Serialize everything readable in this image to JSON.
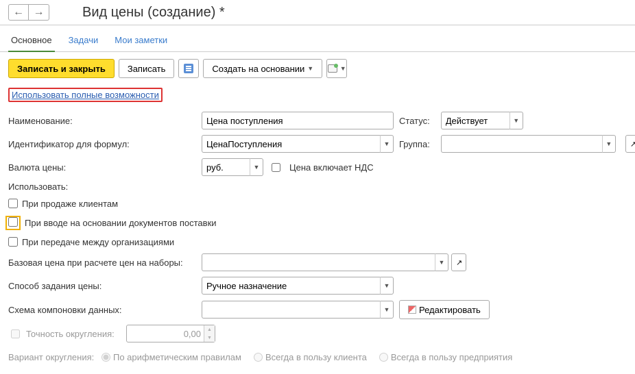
{
  "header": {
    "title": "Вид цены (создание) *"
  },
  "tabs": {
    "main": "Основное",
    "tasks": "Задачи",
    "notes": "Мои заметки"
  },
  "toolbar": {
    "save_close": "Записать и закрыть",
    "save": "Записать",
    "create_based": "Создать на основании"
  },
  "link": {
    "full_options": "Использовать полные возможности"
  },
  "labels": {
    "name": "Наименование:",
    "identifier": "Идентификатор для формул:",
    "currency": "Валюта цены:",
    "status": "Статус:",
    "group": "Группа:",
    "vat_included": "Цена включает НДС",
    "use": "Использовать:",
    "use_sale": "При продаже клиентам",
    "use_supply": "При вводе на основании документов поставки",
    "use_transfer": "При передаче между организациями",
    "base_price": "Базовая цена при расчете цен на наборы:",
    "price_method": "Способ задания цены:",
    "layout_schema": "Схема компоновки данных:",
    "edit": "Редактировать",
    "precision": "Точность округления:",
    "rounding_variant": "Вариант округления:",
    "round_arith": "По арифметическим правилам",
    "round_client": "Всегда в пользу клиента",
    "round_company": "Всегда в пользу предприятия"
  },
  "values": {
    "name": "Цена поступления",
    "identifier": "ЦенаПоступления",
    "currency": "руб.",
    "status": "Действует",
    "group": "",
    "base_price": "",
    "price_method": "Ручное назначение",
    "layout_schema": "",
    "precision": "0,00"
  }
}
